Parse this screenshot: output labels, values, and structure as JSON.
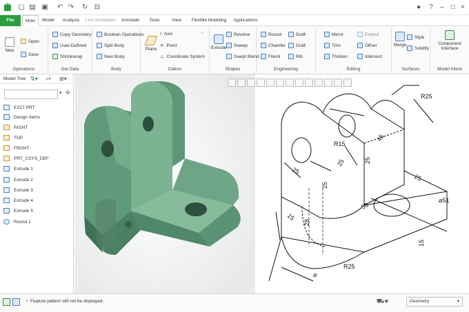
{
  "app": {
    "accent": "#2a9d3f"
  },
  "tabs": [
    {
      "label": "File"
    },
    {
      "label": "Mole"
    },
    {
      "label": "Model"
    },
    {
      "label": "Analysis"
    },
    {
      "label": "Live Simulation"
    },
    {
      "label": "Annotate"
    },
    {
      "label": "Tools"
    },
    {
      "label": "View"
    },
    {
      "label": "Flexible Modeling"
    },
    {
      "label": "Applications"
    }
  ],
  "ribbon": {
    "operations": {
      "label": "Operations",
      "new": "New",
      "open": "Open",
      "save": "Save"
    },
    "get_data": {
      "label": "Get Data",
      "items": [
        "Copy Geometry",
        "User-Defined",
        "Shrinkwrap"
      ]
    },
    "body": {
      "label": "Body",
      "items": [
        "Boolean Operations",
        "Split Body",
        "New Body"
      ]
    },
    "datum": {
      "label": "Datum",
      "plane": "Plane",
      "items": [
        "Axis",
        "Point",
        "Coordinate System"
      ]
    },
    "shapes": {
      "label": "Shapes",
      "extrude": "Extrude",
      "items": [
        "Revolve",
        "Sweep",
        "Swept Blend"
      ]
    },
    "engineering": {
      "label": "Engineering",
      "items": [
        "Round",
        "Chamfer",
        "Fileml",
        "Draft",
        "Draft",
        "Rib"
      ]
    },
    "editing": {
      "label": "Editing",
      "items": [
        "Mirror",
        "Trim",
        "Thicken",
        "Extend",
        "Offset",
        "Intersect"
      ]
    },
    "surfaces": {
      "label": "Surfaces",
      "merge": "Merge",
      "items": [
        "Style",
        "Solidify"
      ]
    },
    "model_intent": {
      "label": "Model Intent",
      "component_line1": "Component",
      "component_line2": "Interface"
    }
  },
  "model_tree": {
    "title": "Model Tree",
    "items": [
      {
        "label": "EX27.PRT",
        "icon": "part-icon"
      },
      {
        "label": "Design Items",
        "icon": "design-items-icon"
      },
      {
        "label": "RIGHT",
        "icon": "datum-plane-icon"
      },
      {
        "label": "TOP",
        "icon": "datum-plane-icon"
      },
      {
        "label": "FRONT",
        "icon": "datum-plane-icon"
      },
      {
        "label": "PRT_CSYS_DEF",
        "icon": "csys-icon"
      },
      {
        "label": "Extrude 1",
        "icon": "extrude-icon"
      },
      {
        "label": "Extrude 2",
        "icon": "extrude-icon"
      },
      {
        "label": "Extrude 3",
        "icon": "extrude-icon"
      },
      {
        "label": "Extrude 4",
        "icon": "extrude-icon"
      },
      {
        "label": "Extrude 5",
        "icon": "extrude-icon"
      },
      {
        "label": "Round 1",
        "icon": "round-icon"
      }
    ]
  },
  "drawing": {
    "dims": [
      "R25",
      "R15",
      "45",
      "25",
      "25",
      "25",
      "25",
      "25",
      "15",
      "28",
      "50",
      "⌀51",
      "15",
      "R25",
      "⌀"
    ]
  },
  "status": {
    "message": "Feature pattern will not be displayed.",
    "filter": "Geometry"
  }
}
